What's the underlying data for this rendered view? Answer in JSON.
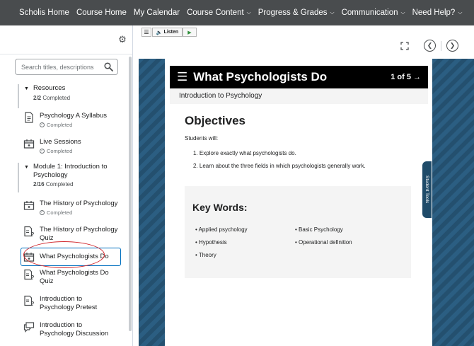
{
  "topnav": {
    "items": [
      {
        "label": "Scholis Home",
        "dropdown": false
      },
      {
        "label": "Course Home",
        "dropdown": false
      },
      {
        "label": "My Calendar",
        "dropdown": false
      },
      {
        "label": "Course Content",
        "dropdown": true
      },
      {
        "label": "Progress & Grades",
        "dropdown": true
      },
      {
        "label": "Communication",
        "dropdown": true
      },
      {
        "label": "Need Help?",
        "dropdown": true
      }
    ]
  },
  "sidebar": {
    "search_placeholder": "Search titles, descriptions",
    "modules": [
      {
        "title": "Resources",
        "status_count": "2/2",
        "status_text": "Completed"
      },
      {
        "title": "Module 1: Introduction to Psychology",
        "status_count": "2/16",
        "status_text": "Completed"
      }
    ],
    "topics": [
      {
        "label": "Psychology A Syllabus",
        "completed": "Completed",
        "icon": "document-icon"
      },
      {
        "label": "Live Sessions",
        "completed": "Completed",
        "icon": "calendar-icon"
      },
      {
        "label": "The History of Psychology",
        "completed": "Completed",
        "icon": "calendar-icon"
      },
      {
        "label": "The History of Psychology Quiz",
        "completed": "",
        "icon": "quiz-icon"
      },
      {
        "label": "What Psychologists Do",
        "completed": "",
        "icon": "calendar-icon"
      },
      {
        "label": "What Psychologists Do Quiz",
        "completed": "",
        "icon": "quiz-icon"
      },
      {
        "label": "Introduction to Psychology Pretest",
        "completed": "",
        "icon": "quiz-icon"
      },
      {
        "label": "Introduction to Psychology Discussion",
        "completed": "",
        "icon": "discussion-icon"
      }
    ]
  },
  "toolbar": {
    "listen_label": "Listen"
  },
  "content": {
    "title": "What Psychologists Do",
    "page_indicator": "1 of 5 →",
    "subtitle": "Introduction to Psychology",
    "objectives_title": "Objectives",
    "students_will": "Students will:",
    "objectives": [
      "1. Explore exactly what psychologists do.",
      "2. Learn about the three fields in which psychologists generally work."
    ],
    "student_tools": "Student Tools",
    "key_words_title": "Key Words:",
    "key_words": [
      "• Applied psychology",
      "• Basic Psychology",
      "• Hypothesis",
      "• Operational definition",
      "• Theory"
    ]
  },
  "colors": {
    "nav_bg": "#494c4e",
    "frame_blue": "#2a5a7d",
    "active_border": "#006fbf",
    "annotation_red": "#d0262b"
  }
}
